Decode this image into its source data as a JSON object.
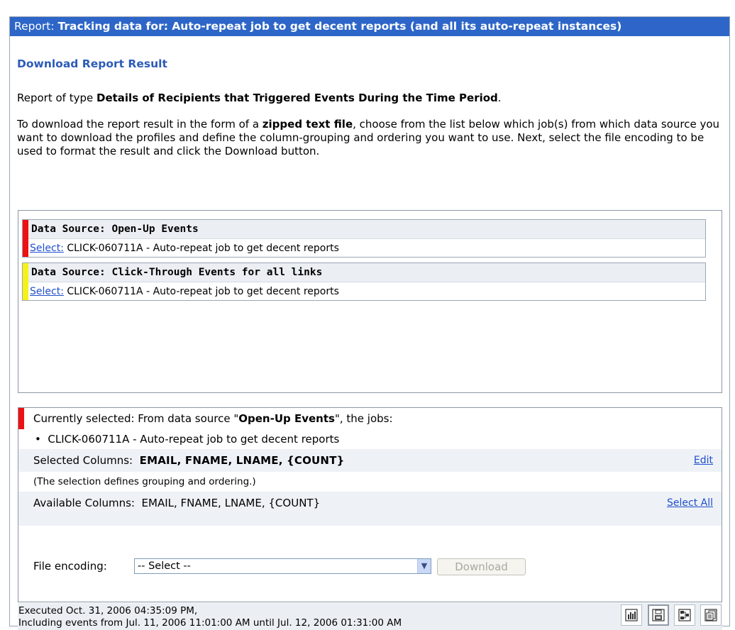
{
  "titlebar": {
    "prefix": "Report:",
    "title": "Tracking data for: Auto-repeat job to get decent reports (and all its auto-repeat instances)"
  },
  "main": {
    "download_title": "Download Report Result",
    "report_type_prefix": "Report of type ",
    "report_type": "Details of Recipients that Triggered Events During the Time Period",
    "report_type_suffix": ".",
    "desc_1": "To download the report result in the form of a ",
    "desc_bold": "zipped text file",
    "desc_2": ", choose from the list below which job(s) from which data source you want to download the profiles and define the column-grouping and ordering you want to use. Next, select the file encoding to be used to format the result and click the Download button."
  },
  "sources": [
    {
      "header": "Data Source: Open-Up Events",
      "color": "#ee1111",
      "select_label": "Select:",
      "job": "CLICK-060711A - Auto-repeat job to get decent reports"
    },
    {
      "header": "Data Source: Click-Through Events for all links",
      "color": "#f5f21a",
      "select_label": "Select:",
      "job": "CLICK-060711A - Auto-repeat job to get decent reports"
    }
  ],
  "selection": {
    "prefix": "Currently selected: From data source \"",
    "source": "Open-Up Events",
    "suffix": "\", the jobs:",
    "job_bullet": "•",
    "job": "CLICK-060711A - Auto-repeat job to get decent reports",
    "selected_columns_label": "Selected Columns:",
    "selected_columns": "EMAIL, FNAME, LNAME, {COUNT}",
    "edit_label": "Edit",
    "note": "(The selection defines grouping and ordering.)",
    "available_columns_label": "Available Columns:",
    "available_columns": "EMAIL, FNAME, LNAME, {COUNT}",
    "select_all_label": "Select All",
    "file_encoding_label": "File encoding:",
    "file_encoding_value": "-- Select --",
    "download_label": "Download"
  },
  "footer": {
    "executed": "Executed Oct. 31, 2006 04:35:09 PM,",
    "including": "Including events from Jul. 11, 2006 11:01:00 AM until Jul. 12, 2006 01:31:00 AM",
    "icons": [
      "bar-chart-icon",
      "export-disk-icon",
      "flowchart-icon",
      "copy-pages-icon"
    ]
  }
}
